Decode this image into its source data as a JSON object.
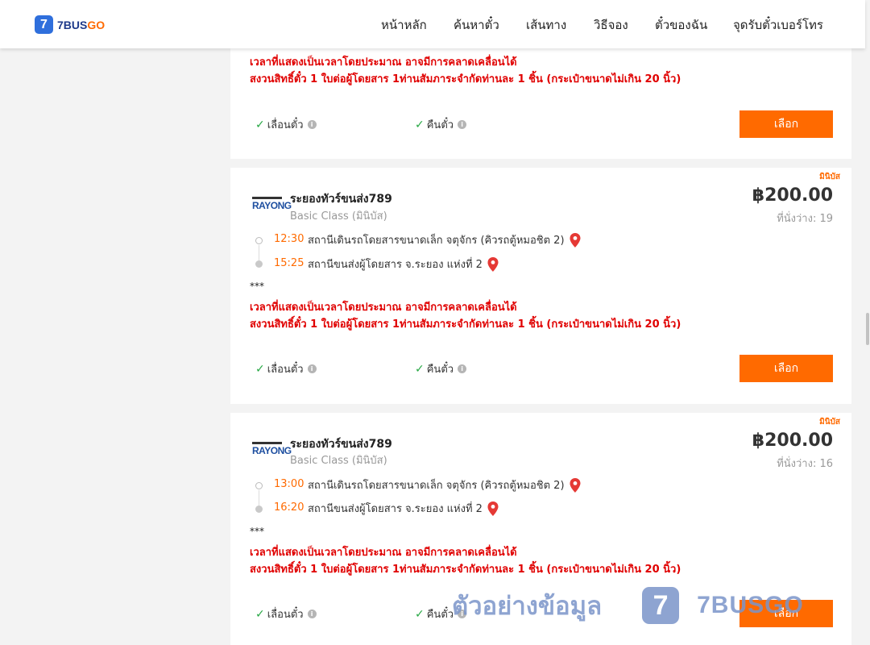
{
  "header": {
    "logo_badge": "7",
    "logo_brand_main": "7BUS",
    "logo_brand_accent": "GO",
    "nav": [
      "หน้าหลัก",
      "ค้นหาตั๋ว",
      "เส้นทาง",
      "วิธีจอง",
      "ตั๋วของฉัน",
      "จุดรับตั๋วเบอร์โทร"
    ]
  },
  "common": {
    "notice_line1": "เวลาที่แสดงเป็นเวลาโดยประมาณ อาจมีการคลาดเคลื่อนได้",
    "notice_line2": "สงวนสิทธิ์ตั๋ว 1 ใบต่อผู้โดยสาร 1ท่านสัมภาระจำกัดท่านละ 1 ชิ้น (กระเป๋าขนาดไม่เกิน 20 นิ้ว)",
    "stars": "***",
    "feature_change": "เลื่อนตั๋ว",
    "feature_refund": "คืนตั๋ว",
    "select_label": "เลือก",
    "info_glyph": "i",
    "check_glyph": "✓"
  },
  "trips": [
    {
      "bus_type_tag": "มินิบัส",
      "operator_logo": "RAYONG",
      "operator": "ระยองทัวร์ขนส่ง789",
      "class": "Basic Class (มินิบัส)",
      "price": "฿200.00",
      "seats": "ที่นั่งว่าง: 19",
      "depart_time": "12:30",
      "depart_station": "สถานีเดินรถโดยสารขนาดเล็ก จตุจักร (คิวรถตู้หมอชิต 2)",
      "arrive_time": "15:25",
      "arrive_station": "สถานีขนส่งผู้โดยสาร จ.ระยอง แห่งที่ 2"
    },
    {
      "bus_type_tag": "มินิบัส",
      "operator_logo": "RAYONG",
      "operator": "ระยองทัวร์ขนส่ง789",
      "class": "Basic Class (มินิบัส)",
      "price": "฿200.00",
      "seats": "ที่นั่งว่าง: 16",
      "depart_time": "13:00",
      "depart_station": "สถานีเดินรถโดยสารขนาดเล็ก จตุจักร (คิวรถตู้หมอชิต 2)",
      "arrive_time": "16:20",
      "arrive_station": "สถานีขนส่งผู้โดยสาร จ.ระยอง แห่งที่ 2"
    }
  ],
  "watermark": {
    "text": "ตัวอย่างข้อมูล",
    "badge": "7",
    "brand": "7BUSGO"
  },
  "colors": {
    "accent": "#ff6a00",
    "notice": "#e00000",
    "brand_blue": "#2f6fdc",
    "check": "#27a844"
  }
}
